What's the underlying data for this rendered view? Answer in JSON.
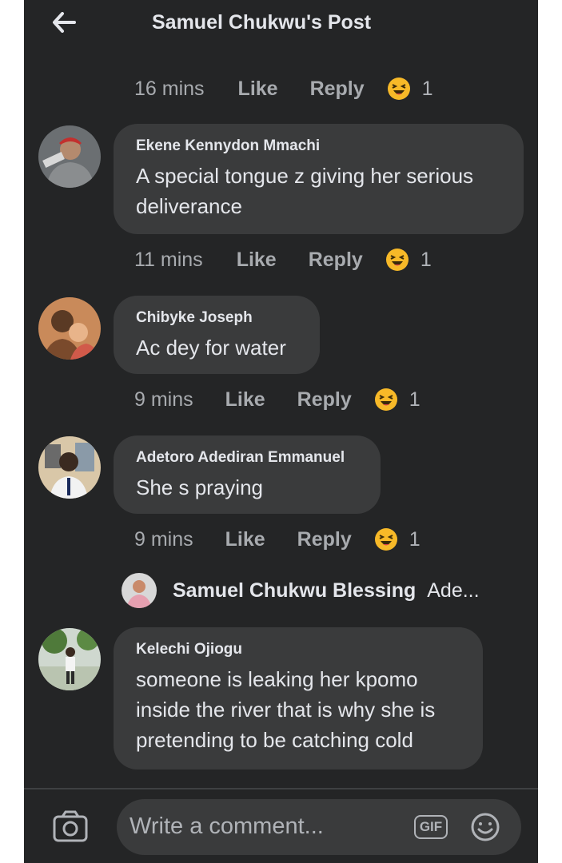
{
  "header": {
    "title": "Samuel Chukwu's Post"
  },
  "comments": [
    {
      "time": "16 mins",
      "like": "Like",
      "reply": "Reply",
      "reactions": "1"
    },
    {
      "name": "Ekene Kennydon Mmachi",
      "text": "A special tongue z giving her serious deliverance",
      "time": "11 mins",
      "like": "Like",
      "reply": "Reply",
      "reactions": "1"
    },
    {
      "name": "Chibyke Joseph",
      "text": "Ac dey for water",
      "time": "9 mins",
      "like": "Like",
      "reply": "Reply",
      "reactions": "1"
    },
    {
      "name": "Adetoro Adediran Emmanuel",
      "text": "She s praying",
      "time": "9 mins",
      "like": "Like",
      "reply": "Reply",
      "reactions": "1"
    },
    {
      "name": "Kelechi Ojiogu",
      "text": "someone is leaking her kpomo inside the river that is why she is pretending to be catching cold"
    }
  ],
  "reply_preview": {
    "name": "Samuel Chukwu Blessing",
    "text": "Ade..."
  },
  "composer": {
    "placeholder": "Write a comment...",
    "gif_label": "GIF"
  },
  "colors": {
    "background": "#242526",
    "bubble": "#3a3b3c",
    "text": "#e4e6eb",
    "muted": "#a8abaf",
    "haha": "#f7b928"
  },
  "icons": [
    "back-arrow-icon",
    "haha-reaction-icon",
    "camera-icon",
    "gif-icon",
    "emoji-icon"
  ]
}
